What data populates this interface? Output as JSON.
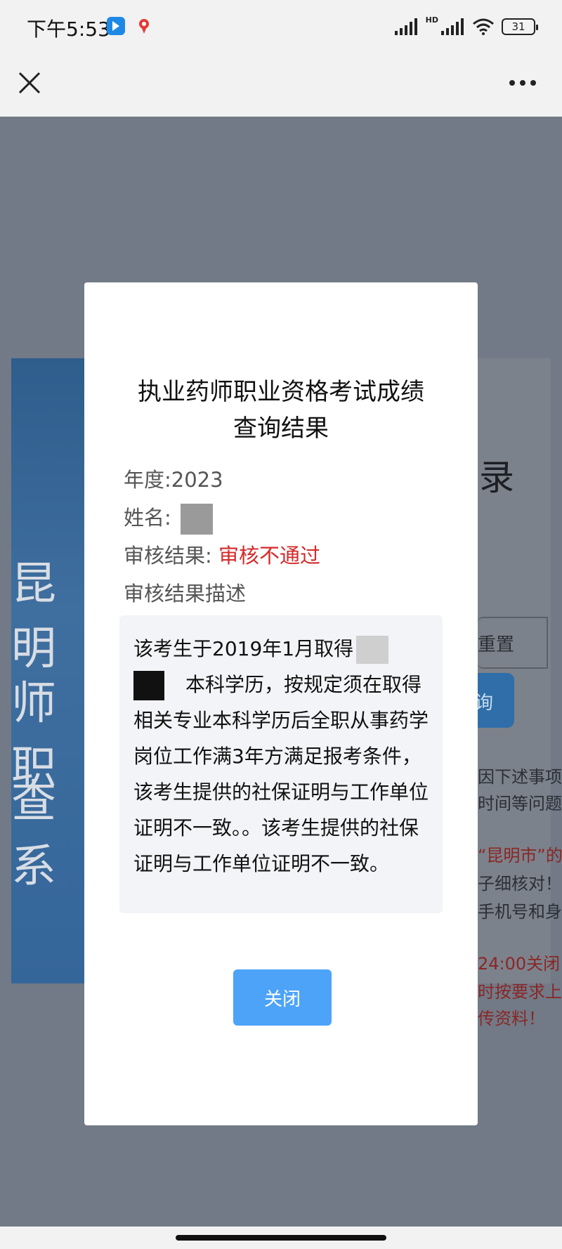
{
  "status_bar": {
    "time": "下午5:53",
    "hd_label": "HD",
    "battery_level": "31",
    "icons": [
      "signal-icon",
      "hd-signal-icon",
      "wifi-icon",
      "battery-icon"
    ]
  },
  "nav": {
    "close_icon": "close-icon",
    "more_icon": "more-dots-icon"
  },
  "background_page": {
    "side_chars": [
      "昆明",
      "师职",
      "查系"
    ],
    "title_fragment": "录",
    "reset_label": "重置",
    "search_fragment": "询",
    "notice_lines": [
      "因下述事项",
      "时间等问题",
      "“昆明市”的",
      "子细核对！",
      "手机号和身",
      "24:00关闭",
      "时按要求上",
      "传资料！"
    ]
  },
  "modal": {
    "title": "执业药师职业资格考试成绩查询结果",
    "year_label": "年度:",
    "year_value": "2023",
    "name_label": "姓名:",
    "result_label": "审核结果:",
    "result_value": "审核不通过",
    "desc_label": "审核结果描述",
    "desc_part1": "该考生于2019年1月取得",
    "desc_part2": "本科学历，按规定须在取得相关专业本科学历后全职从事药学岗位工作满3年方满足报考条件，该考生提供的社保证明与工作单位证明不一致。。该考生提供的社保证明与工作单位证明不一致。",
    "close_label": "关闭"
  },
  "colors": {
    "accent_blue": "#4da3f8",
    "result_red": "#d42a2a",
    "overlay": "#717a86"
  }
}
